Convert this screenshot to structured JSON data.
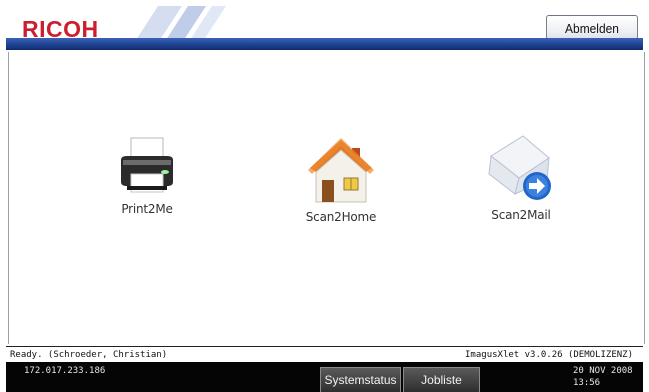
{
  "header": {
    "brand": "RICOH",
    "logout_label": "Abmelden"
  },
  "apps": [
    {
      "label": "Print2Me",
      "icon": "printer-icon"
    },
    {
      "label": "Scan2Home",
      "icon": "house-icon"
    },
    {
      "label": "Scan2Mail",
      "icon": "envelope-arrow-icon"
    }
  ],
  "status": {
    "message": "Ready. (Schroeder, Christian)",
    "version": "ImagusXlet v3.0.26 (DEMOLIZENZ)"
  },
  "footer": {
    "ip": "172.017.233.186",
    "systemstatus_label": "Systemstatus",
    "jobliste_label": "Jobliste",
    "date": "20 NOV  2008",
    "time": "13:56"
  },
  "colors": {
    "brand_red": "#cc1f2d",
    "band_blue": "#1c3f8f",
    "footer_black": "#050505"
  }
}
